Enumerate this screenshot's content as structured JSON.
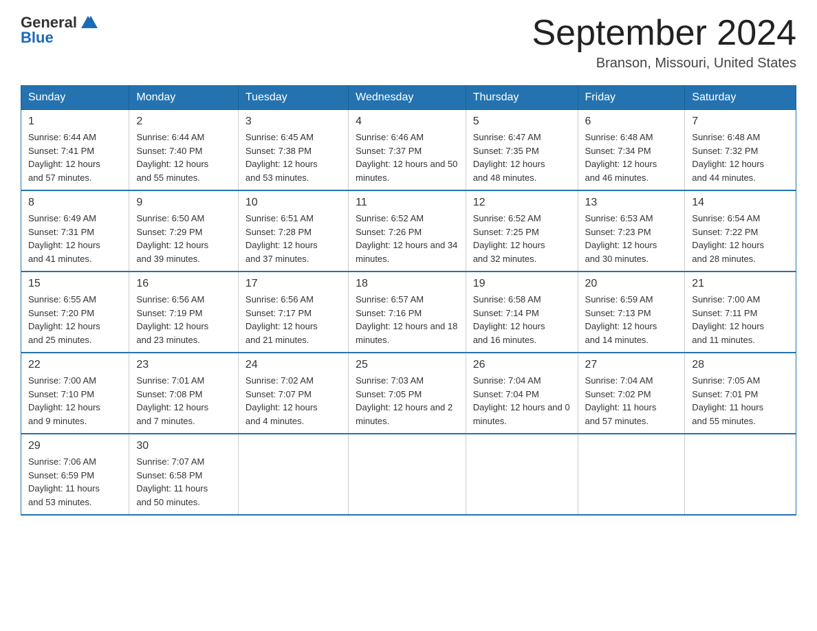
{
  "logo": {
    "general": "General",
    "blue": "Blue",
    "triangle_color": "#1a6bb5"
  },
  "header": {
    "month_year": "September 2024",
    "location": "Branson, Missouri, United States"
  },
  "weekdays": [
    "Sunday",
    "Monday",
    "Tuesday",
    "Wednesday",
    "Thursday",
    "Friday",
    "Saturday"
  ],
  "weeks": [
    [
      {
        "day": "1",
        "sunrise": "6:44 AM",
        "sunset": "7:41 PM",
        "daylight": "12 hours and 57 minutes."
      },
      {
        "day": "2",
        "sunrise": "6:44 AM",
        "sunset": "7:40 PM",
        "daylight": "12 hours and 55 minutes."
      },
      {
        "day": "3",
        "sunrise": "6:45 AM",
        "sunset": "7:38 PM",
        "daylight": "12 hours and 53 minutes."
      },
      {
        "day": "4",
        "sunrise": "6:46 AM",
        "sunset": "7:37 PM",
        "daylight": "12 hours and 50 minutes."
      },
      {
        "day": "5",
        "sunrise": "6:47 AM",
        "sunset": "7:35 PM",
        "daylight": "12 hours and 48 minutes."
      },
      {
        "day": "6",
        "sunrise": "6:48 AM",
        "sunset": "7:34 PM",
        "daylight": "12 hours and 46 minutes."
      },
      {
        "day": "7",
        "sunrise": "6:48 AM",
        "sunset": "7:32 PM",
        "daylight": "12 hours and 44 minutes."
      }
    ],
    [
      {
        "day": "8",
        "sunrise": "6:49 AM",
        "sunset": "7:31 PM",
        "daylight": "12 hours and 41 minutes."
      },
      {
        "day": "9",
        "sunrise": "6:50 AM",
        "sunset": "7:29 PM",
        "daylight": "12 hours and 39 minutes."
      },
      {
        "day": "10",
        "sunrise": "6:51 AM",
        "sunset": "7:28 PM",
        "daylight": "12 hours and 37 minutes."
      },
      {
        "day": "11",
        "sunrise": "6:52 AM",
        "sunset": "7:26 PM",
        "daylight": "12 hours and 34 minutes."
      },
      {
        "day": "12",
        "sunrise": "6:52 AM",
        "sunset": "7:25 PM",
        "daylight": "12 hours and 32 minutes."
      },
      {
        "day": "13",
        "sunrise": "6:53 AM",
        "sunset": "7:23 PM",
        "daylight": "12 hours and 30 minutes."
      },
      {
        "day": "14",
        "sunrise": "6:54 AM",
        "sunset": "7:22 PM",
        "daylight": "12 hours and 28 minutes."
      }
    ],
    [
      {
        "day": "15",
        "sunrise": "6:55 AM",
        "sunset": "7:20 PM",
        "daylight": "12 hours and 25 minutes."
      },
      {
        "day": "16",
        "sunrise": "6:56 AM",
        "sunset": "7:19 PM",
        "daylight": "12 hours and 23 minutes."
      },
      {
        "day": "17",
        "sunrise": "6:56 AM",
        "sunset": "7:17 PM",
        "daylight": "12 hours and 21 minutes."
      },
      {
        "day": "18",
        "sunrise": "6:57 AM",
        "sunset": "7:16 PM",
        "daylight": "12 hours and 18 minutes."
      },
      {
        "day": "19",
        "sunrise": "6:58 AM",
        "sunset": "7:14 PM",
        "daylight": "12 hours and 16 minutes."
      },
      {
        "day": "20",
        "sunrise": "6:59 AM",
        "sunset": "7:13 PM",
        "daylight": "12 hours and 14 minutes."
      },
      {
        "day": "21",
        "sunrise": "7:00 AM",
        "sunset": "7:11 PM",
        "daylight": "12 hours and 11 minutes."
      }
    ],
    [
      {
        "day": "22",
        "sunrise": "7:00 AM",
        "sunset": "7:10 PM",
        "daylight": "12 hours and 9 minutes."
      },
      {
        "day": "23",
        "sunrise": "7:01 AM",
        "sunset": "7:08 PM",
        "daylight": "12 hours and 7 minutes."
      },
      {
        "day": "24",
        "sunrise": "7:02 AM",
        "sunset": "7:07 PM",
        "daylight": "12 hours and 4 minutes."
      },
      {
        "day": "25",
        "sunrise": "7:03 AM",
        "sunset": "7:05 PM",
        "daylight": "12 hours and 2 minutes."
      },
      {
        "day": "26",
        "sunrise": "7:04 AM",
        "sunset": "7:04 PM",
        "daylight": "12 hours and 0 minutes."
      },
      {
        "day": "27",
        "sunrise": "7:04 AM",
        "sunset": "7:02 PM",
        "daylight": "11 hours and 57 minutes."
      },
      {
        "day": "28",
        "sunrise": "7:05 AM",
        "sunset": "7:01 PM",
        "daylight": "11 hours and 55 minutes."
      }
    ],
    [
      {
        "day": "29",
        "sunrise": "7:06 AM",
        "sunset": "6:59 PM",
        "daylight": "11 hours and 53 minutes."
      },
      {
        "day": "30",
        "sunrise": "7:07 AM",
        "sunset": "6:58 PM",
        "daylight": "11 hours and 50 minutes."
      },
      null,
      null,
      null,
      null,
      null
    ]
  ]
}
